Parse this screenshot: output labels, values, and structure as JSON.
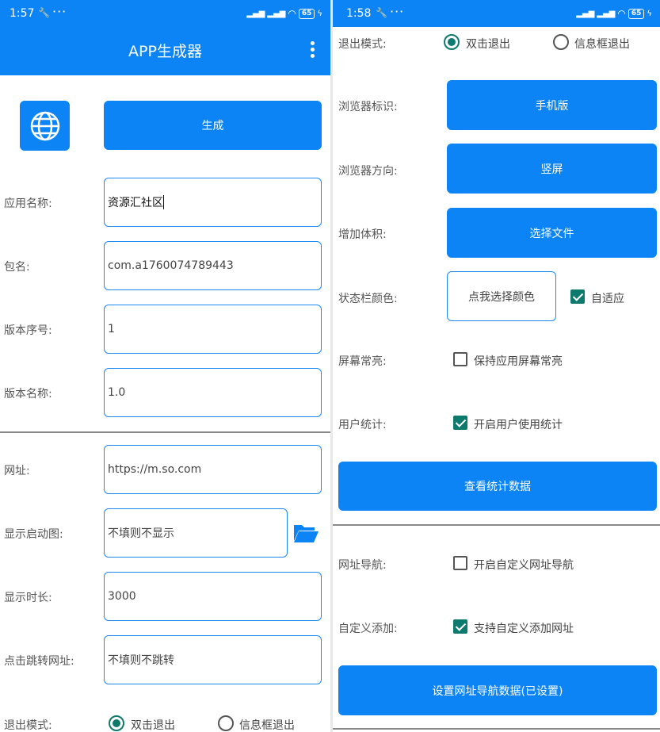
{
  "left": {
    "status": {
      "time": "1:57",
      "battery": "65"
    },
    "app_title": "APP生成器",
    "generate_label": "生成",
    "form": {
      "app_name_label": "应用名称:",
      "app_name_value": "资源汇社区",
      "package_label": "包名:",
      "package_value": "com.a1760074789443",
      "version_code_label": "版本序号:",
      "version_code_value": "1",
      "version_name_label": "版本名称:",
      "version_name_value": "1.0",
      "url_label": "网址:",
      "url_value": "https://m.so.com",
      "splash_label": "显示启动图:",
      "splash_placeholder": "不填则不显示",
      "duration_label": "显示时长:",
      "duration_value": "3000",
      "click_url_label": "点击跳转网址:",
      "click_url_placeholder": "不填则不跳转",
      "exit_label": "退出模式:",
      "exit_option_1": "双击退出",
      "exit_option_2": "信息框退出"
    }
  },
  "right": {
    "status": {
      "time": "1:58",
      "battery": "65"
    },
    "exit_label": "退出模式:",
    "exit_option_1": "双击退出",
    "exit_option_2": "信息框退出",
    "browser_id_label": "浏览器标识:",
    "browser_id_value": "手机版",
    "browser_orient_label": "浏览器方向:",
    "browser_orient_value": "竖屏",
    "add_size_label": "增加体积:",
    "add_size_value": "选择文件",
    "statusbar_color_label": "状态栏颜色:",
    "statusbar_color_button": "点我选择颜色",
    "adaptive_label": "自适应",
    "screen_on_label": "屏幕常亮:",
    "screen_on_option": "保持应用屏幕常亮",
    "user_stats_label": "用户统计:",
    "user_stats_option": "开启用户使用统计",
    "view_stats_button": "查看统计数据",
    "url_nav_label": "网址导航:",
    "url_nav_option": "开启自定义网址导航",
    "custom_add_label": "自定义添加:",
    "custom_add_option": "支持自定义添加网址",
    "set_nav_button": "设置网址导航数据(已设置)"
  },
  "colors": {
    "primary": "#0c84f5",
    "accent": "#0e7a6e"
  },
  "icons": [
    "wrench-icon",
    "more-dots-icon",
    "signal-icon",
    "wifi-icon",
    "battery-icon",
    "charging-icon",
    "globe-icon",
    "folder-open-icon",
    "overflow-menu-icon"
  ]
}
